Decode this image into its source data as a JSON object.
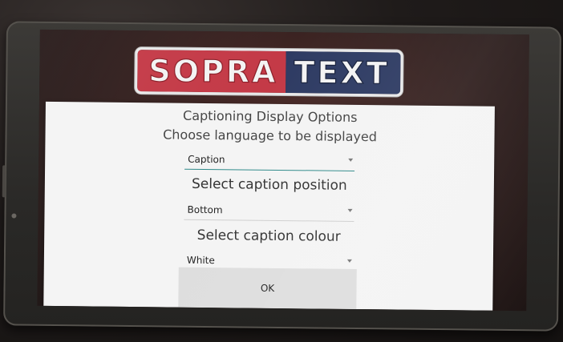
{
  "logo": {
    "left_text": "SOPRA",
    "right_text": "TEXT",
    "colors": {
      "left": "#c43a47",
      "right": "#2e3b63"
    }
  },
  "dialog": {
    "title": "Captioning Display Options",
    "subtitle": "Choose language to be displayed",
    "language_spinner": {
      "value": "Caption"
    },
    "position_label": "Select caption position",
    "position_spinner": {
      "value": "Bottom"
    },
    "colour_label": "Select caption colour",
    "colour_spinner": {
      "value": "White"
    },
    "ok_label": "OK"
  },
  "colors": {
    "accent": "#2f8a8a",
    "dialog_bg": "#f4f4f4",
    "button_bg": "#dedede"
  }
}
